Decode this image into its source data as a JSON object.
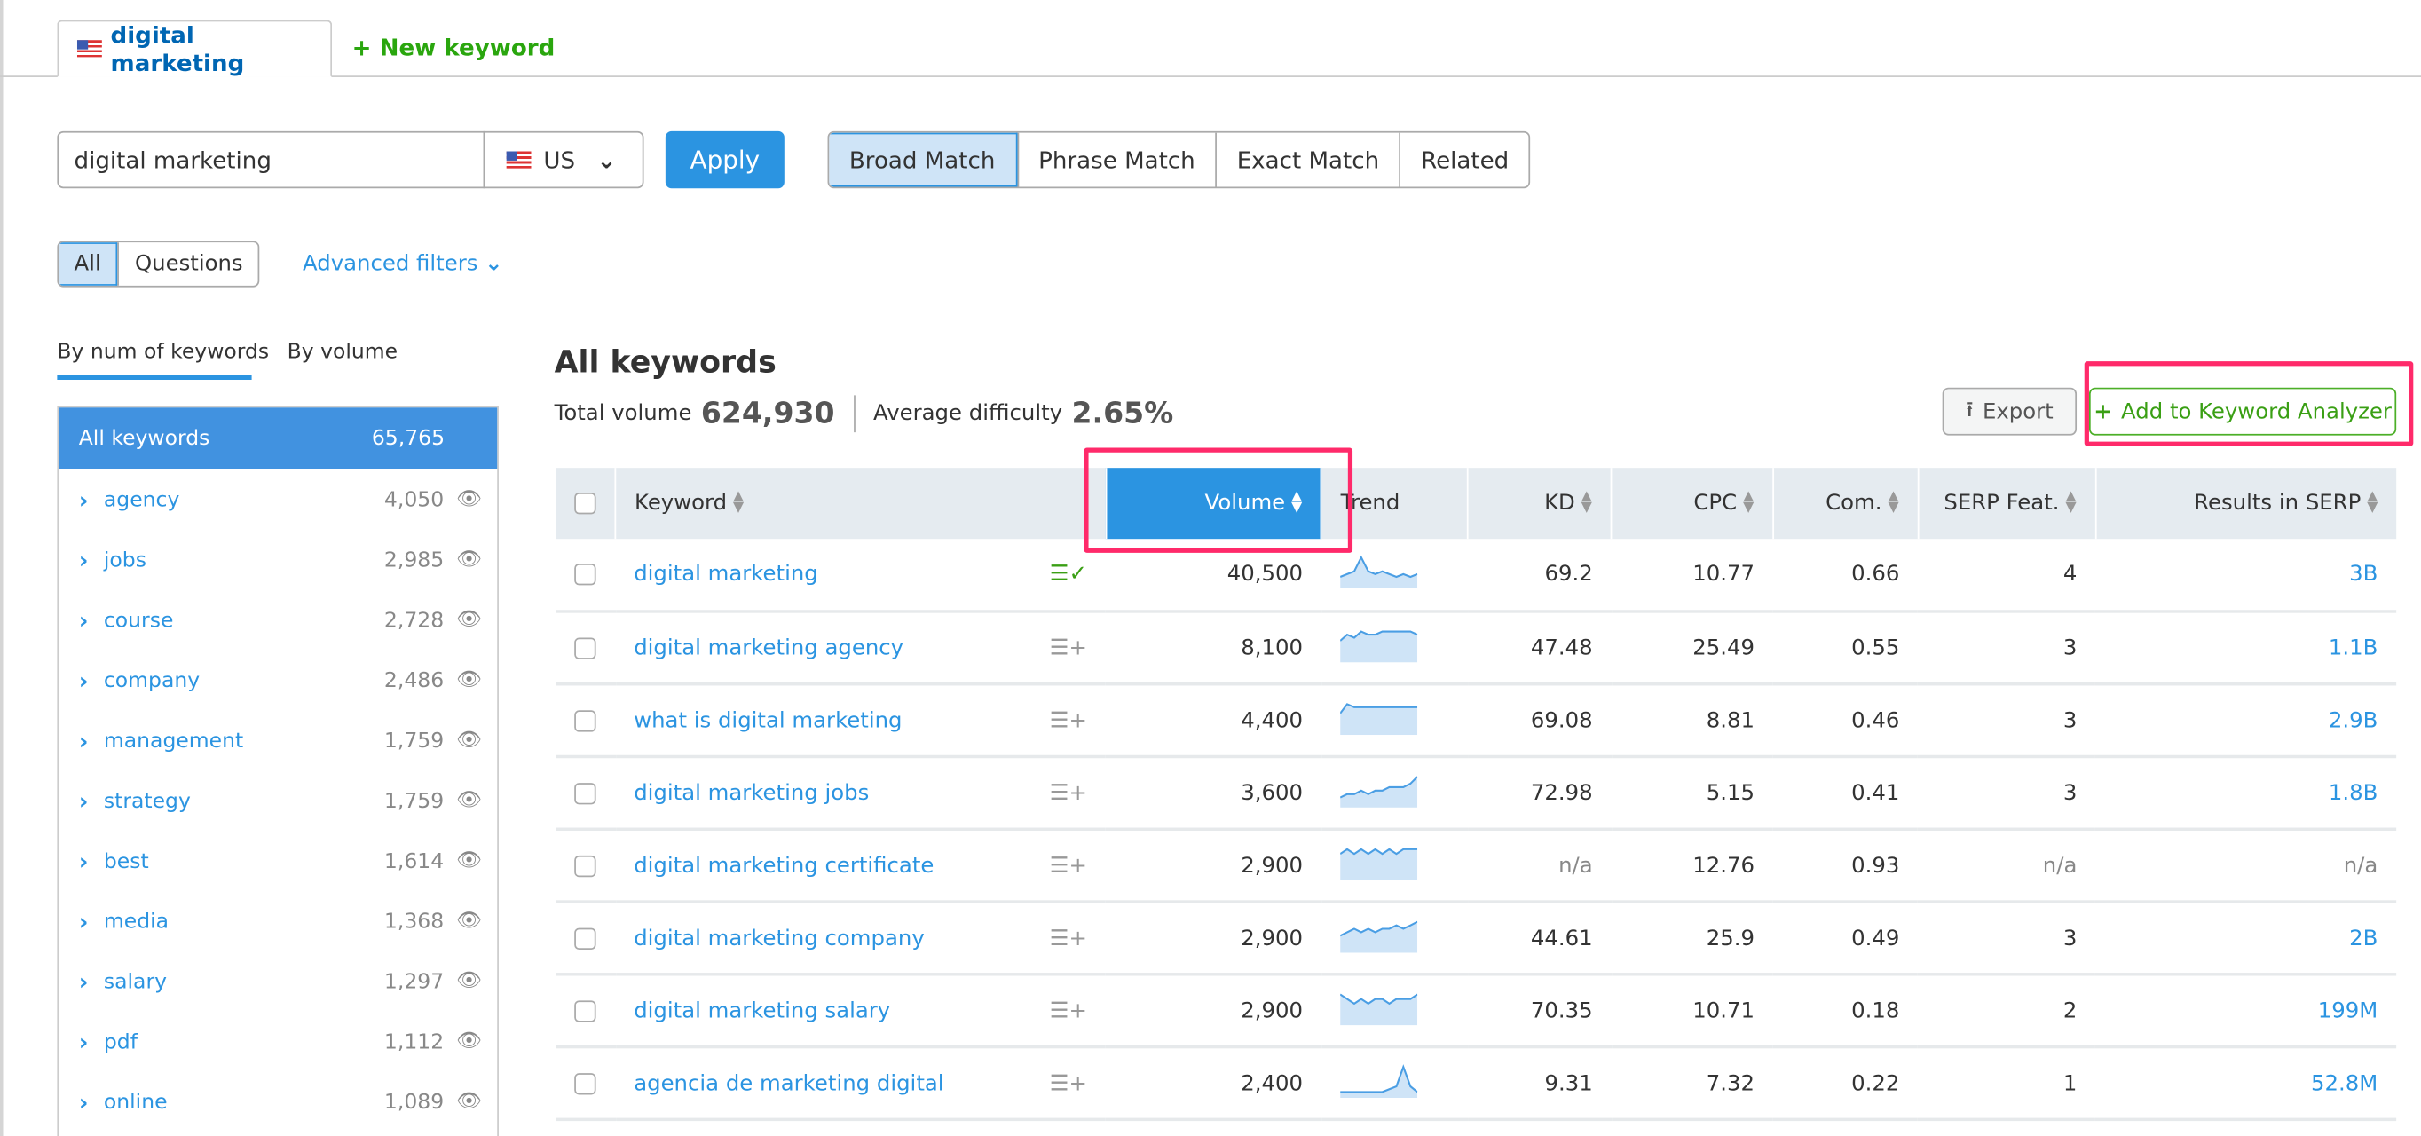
{
  "tabs": {
    "active": "digital marketing",
    "new_keyword": "New keyword"
  },
  "search": {
    "value": "digital marketing",
    "country": "US",
    "apply": "Apply"
  },
  "match_types": [
    "Broad Match",
    "Phrase Match",
    "Exact Match",
    "Related"
  ],
  "match_selected": "Broad Match",
  "filters": {
    "all": "All",
    "questions": "Questions",
    "advanced": "Advanced filters"
  },
  "sidebar": {
    "tabs": [
      "By num of keywords",
      "By volume"
    ],
    "all": {
      "label": "All keywords",
      "count": "65,765"
    },
    "groups": [
      {
        "label": "agency",
        "count": "4,050"
      },
      {
        "label": "jobs",
        "count": "2,985"
      },
      {
        "label": "course",
        "count": "2,728"
      },
      {
        "label": "company",
        "count": "2,486"
      },
      {
        "label": "management",
        "count": "1,759"
      },
      {
        "label": "strategy",
        "count": "1,759"
      },
      {
        "label": "best",
        "count": "1,614"
      },
      {
        "label": "media",
        "count": "1,368"
      },
      {
        "label": "salary",
        "count": "1,297"
      },
      {
        "label": "pdf",
        "count": "1,112"
      },
      {
        "label": "online",
        "count": "1,089"
      }
    ]
  },
  "main": {
    "title": "All keywords",
    "total_volume_label": "Total volume",
    "total_volume": "624,930",
    "avg_difficulty_label": "Average difficulty",
    "avg_difficulty": "2.65%",
    "export": "Export",
    "add_analyzer": "Add to Keyword Analyzer"
  },
  "colors": {
    "accent": "#2b94e1",
    "green": "#3a9f14",
    "highlight": "#ff2a6a"
  },
  "table": {
    "headers": [
      "Keyword",
      "Volume",
      "Trend",
      "KD",
      "CPC",
      "Com.",
      "SERP Feat.",
      "Results in SERP"
    ],
    "sorted_by": "Volume",
    "rows": [
      {
        "keyword": "digital marketing",
        "added": true,
        "volume": "40,500",
        "trend": [
          3,
          4,
          5,
          10,
          5,
          4,
          5,
          4,
          3,
          4,
          3,
          4
        ],
        "kd": "69.2",
        "cpc": "10.77",
        "com": "0.66",
        "serp": "4",
        "results": "3B"
      },
      {
        "keyword": "digital marketing agency",
        "added": false,
        "volume": "8,100",
        "trend": [
          6,
          8,
          7,
          9,
          8,
          8,
          9,
          9,
          9,
          9,
          9,
          8
        ],
        "kd": "47.48",
        "cpc": "25.49",
        "com": "0.55",
        "serp": "3",
        "results": "1.1B"
      },
      {
        "keyword": "what is digital marketing",
        "added": false,
        "volume": "4,400",
        "trend": [
          6,
          9,
          8,
          8,
          8,
          8,
          8,
          8,
          8,
          8,
          8,
          8
        ],
        "kd": "69.08",
        "cpc": "8.81",
        "com": "0.46",
        "serp": "3",
        "results": "2.9B"
      },
      {
        "keyword": "digital marketing jobs",
        "added": false,
        "volume": "3,600",
        "trend": [
          2,
          3,
          3,
          4,
          3,
          4,
          4,
          5,
          5,
          5,
          6,
          8
        ],
        "kd": "72.98",
        "cpc": "5.15",
        "com": "0.41",
        "serp": "3",
        "results": "1.8B"
      },
      {
        "keyword": "digital marketing certificate",
        "added": false,
        "volume": "2,900",
        "trend": [
          5,
          6,
          5,
          6,
          5,
          6,
          5,
          6,
          5,
          6,
          6,
          6
        ],
        "kd": "n/a",
        "cpc": "12.76",
        "com": "0.93",
        "serp": "n/a",
        "results": "n/a"
      },
      {
        "keyword": "digital marketing company",
        "added": false,
        "volume": "2,900",
        "trend": [
          4,
          5,
          6,
          5,
          6,
          5,
          6,
          6,
          7,
          6,
          7,
          8
        ],
        "kd": "44.61",
        "cpc": "25.9",
        "com": "0.49",
        "serp": "3",
        "results": "2B"
      },
      {
        "keyword": "digital marketing salary",
        "added": false,
        "volume": "2,900",
        "trend": [
          6,
          5,
          4,
          5,
          4,
          5,
          5,
          4,
          5,
          5,
          5,
          6
        ],
        "kd": "70.35",
        "cpc": "10.71",
        "com": "0.18",
        "serp": "2",
        "results": "199M"
      },
      {
        "keyword": "agencia de marketing digital",
        "added": false,
        "volume": "2,400",
        "trend": [
          1,
          1,
          1,
          1,
          1,
          1,
          1,
          2,
          3,
          10,
          3,
          1
        ],
        "kd": "9.31",
        "cpc": "7.32",
        "com": "0.22",
        "serp": "1",
        "results": "52.8M"
      }
    ]
  }
}
